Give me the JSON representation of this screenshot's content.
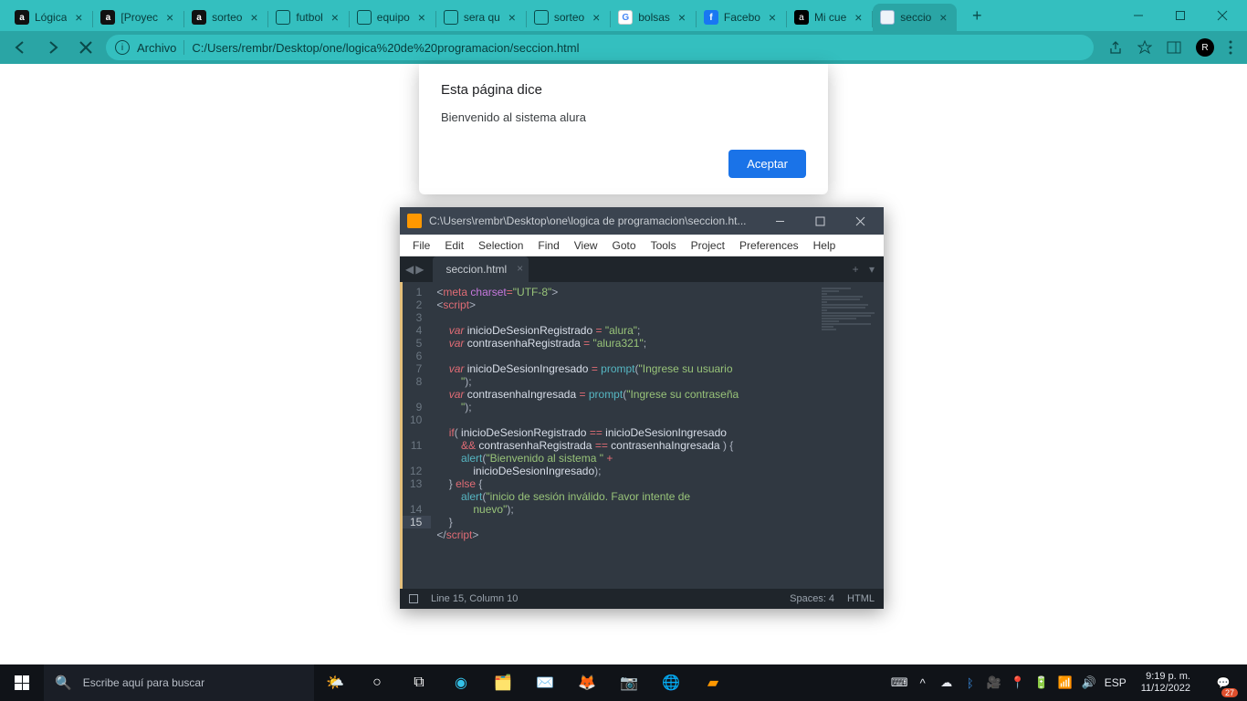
{
  "browser": {
    "tabs": [
      {
        "title": "Lógica",
        "fav": "a"
      },
      {
        "title": "[Proyec",
        "fav": "a"
      },
      {
        "title": "sorteo",
        "fav": "a"
      },
      {
        "title": "futbol",
        "fav": "globe"
      },
      {
        "title": "equipo",
        "fav": "globe"
      },
      {
        "title": "sera qu",
        "fav": "globe"
      },
      {
        "title": "sorteo",
        "fav": "globe"
      },
      {
        "title": "bolsas",
        "fav": "g"
      },
      {
        "title": "Facebo",
        "fav": "fb"
      },
      {
        "title": "Mi cue",
        "fav": "al"
      },
      {
        "title": "seccio",
        "fav": "doc",
        "active": true
      }
    ],
    "address": {
      "scheme_label": "Archivo",
      "path": "C:/Users/rembr/Desktop/one/logica%20de%20programacion/seccion.html"
    }
  },
  "alert": {
    "title": "Esta página dice",
    "message": "Bienvenido al sistema alura",
    "ok": "Aceptar"
  },
  "sublime": {
    "title": "C:\\Users\\rembr\\Desktop\\one\\logica de programacion\\seccion.ht...",
    "menu": [
      "File",
      "Edit",
      "Selection",
      "Find",
      "View",
      "Goto",
      "Tools",
      "Project",
      "Preferences",
      "Help"
    ],
    "tab": "seccion.html",
    "line_numbers": [
      "1",
      "2",
      "3",
      "4",
      "5",
      "6",
      "7",
      "8",
      "",
      "9",
      "10",
      "",
      "11",
      "",
      "12",
      "13",
      "",
      "14",
      "15"
    ],
    "current_line_index": 18,
    "status": {
      "pos": "Line 15, Column 10",
      "spaces": "Spaces: 4",
      "syntax": "HTML"
    },
    "code": {
      "l1a": "meta",
      "l1b": "charset",
      "l1c": "\"UTF-8\"",
      "l2": "script",
      "l4kw": "var",
      "l4v": "inicioDeSesionRegistrado",
      "l4s": "\"alura\"",
      "l5kw": "var",
      "l5v": "contrasenhaRegistrada",
      "l5s": "\"alura321\"",
      "l7kw": "var",
      "l7v": "inicioDeSesionIngresado",
      "l7fn": "prompt",
      "l7s": "\"Ingrese su usuario",
      "l7s2": "\"",
      "l8kw": "var",
      "l8v": "contrasenhaIngresada",
      "l8fn": "prompt",
      "l8s": "\"Ingrese su contraseña",
      "l8s2": "\"",
      "l10if": "if",
      "l10a": "inicioDeSesionRegistrado",
      "l10b": "inicioDeSesionIngresado",
      "l10c": "contrasenhaRegistrada",
      "l10d": "contrasenhaIngresada",
      "l11fn": "alert",
      "l11s": "\"Bienvenido al sistema \"",
      "l11v": "inicioDeSesionIngresado",
      "l12else": "else",
      "l13fn": "alert",
      "l13s": "\"inicio de sesión inválido. Favor intente de",
      "l13s2": "nuevo\"",
      "l15": "script"
    }
  },
  "taskbar": {
    "search_placeholder": "Escribe aquí para buscar",
    "lang": "ESP",
    "time": "9:19 p. m.",
    "date": "11/12/2022",
    "notif_count": "27"
  }
}
